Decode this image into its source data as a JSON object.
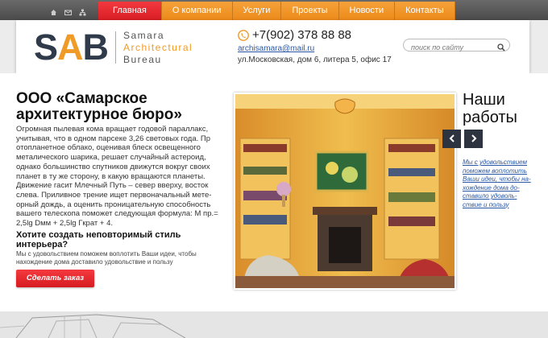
{
  "nav": {
    "items": [
      {
        "label": "Главная",
        "active": true
      },
      {
        "label": "О компании",
        "active": false
      },
      {
        "label": "Услуги",
        "active": false
      },
      {
        "label": "Проекты",
        "active": false
      },
      {
        "label": "Новости",
        "active": false
      },
      {
        "label": "Контакты",
        "active": false
      }
    ]
  },
  "utility_icons": [
    "home-icon",
    "mail-icon",
    "sitemap-icon"
  ],
  "logo": {
    "s": "S",
    "a": "A",
    "b": "B",
    "line1": "Samara",
    "line2": "Architectural",
    "line3": "Bureau"
  },
  "contacts": {
    "phone": "+7(902) 378 88 88",
    "email": "archisamara@mail.ru",
    "address": "ул.Московская, дом 6, литера 5, офис 17"
  },
  "search": {
    "placeholder": "поиск по сайту"
  },
  "main": {
    "title": "ООО «Самарское архитектурное бюро»",
    "description": "Огромная пылевая кома вращает годовой параллакс, учитывая, что в одном парсеке 3,26 световых года. Пр отопланетное облако, оценивая блеск освещенного металического шарика, решает случайный астероид, однако большинство спутников движутся вокруг своих планет в ту же сторону, в какую вращаются планеты. Движение гасит Млечный Путь – север вверху, восток слева. Приливное трение ищет первоначальный мете-орный дождь, а оценить проницательную способность вашего телескопа поможет следующая формула: М пр.= 2,5lg Dмм + 2,5lg Гкрат + 4.",
    "subtitle": "Хотите создать неповторимый стиль интерьера?",
    "subdescription": "Мы с удовольствием поможем воплотить Ваши идеи, чтобы нахождение дома доставило удовольствие и пользу",
    "order_button": "Сделать заказ"
  },
  "works": {
    "title": "Наши работы",
    "link_text": "Мы с удовольствием поможем воплотить Ваши идеи, чтобы на-хождение дома до-ставило удоволь-ствие и пользу"
  },
  "colors": {
    "accent_orange": "#f09a27",
    "accent_red": "#d81e24",
    "dark": "#2d3440",
    "link": "#2a58a6"
  }
}
